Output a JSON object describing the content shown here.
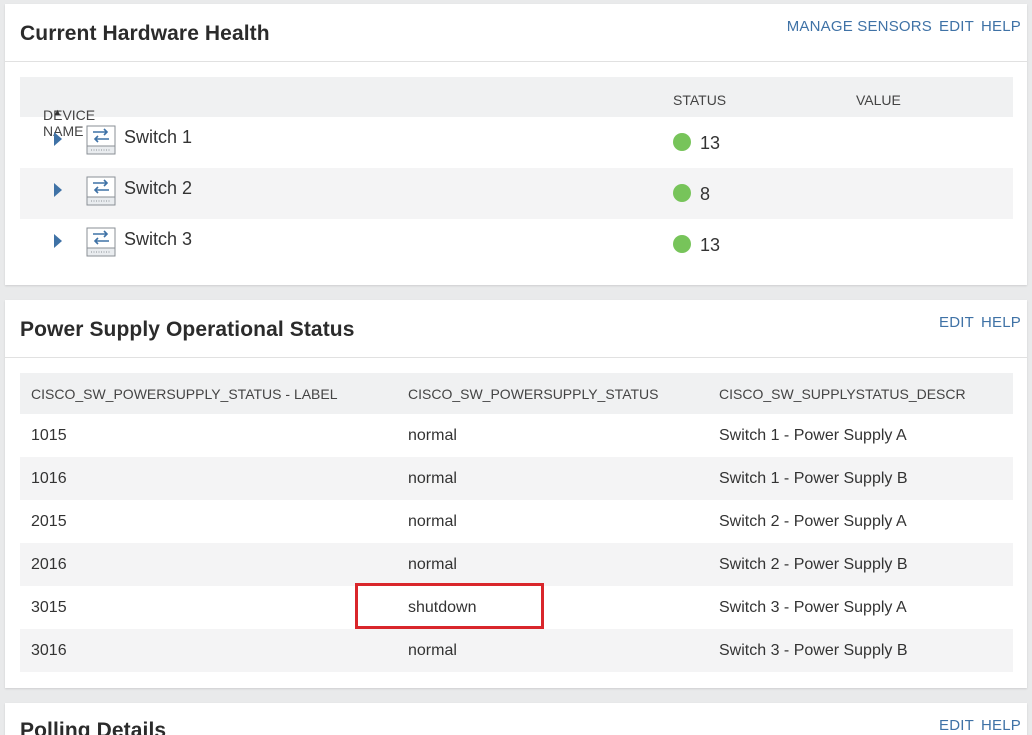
{
  "hardware_health": {
    "title": "Current Hardware Health",
    "links": [
      "MANAGE SENSORS",
      "EDIT",
      "HELP"
    ],
    "columns": {
      "device_name": "DEVICE NAME",
      "status": "STATUS",
      "value": "VALUE"
    },
    "rows": [
      {
        "name": "Switch 1",
        "status": "13"
      },
      {
        "name": "Switch 2",
        "status": "8"
      },
      {
        "name": "Switch 3",
        "status": "13"
      }
    ],
    "status_color": "#77c45a"
  },
  "power_supply": {
    "title": "Power Supply Operational Status",
    "links": [
      "EDIT",
      "HELP"
    ],
    "columns": [
      "CISCO_SW_POWERSUPPLY_STATUS - LABEL",
      "CISCO_SW_POWERSUPPLY_STATUS",
      "CISCO_SW_SUPPLYSTATUS_DESCR"
    ],
    "rows": [
      [
        "1015",
        "normal",
        "Switch 1 - Power Supply A"
      ],
      [
        "1016",
        "normal",
        "Switch 1 - Power Supply B"
      ],
      [
        "2015",
        "normal",
        "Switch 2 - Power Supply A"
      ],
      [
        "2016",
        "normal",
        "Switch 2 - Power Supply B"
      ],
      [
        "3015",
        "shutdown",
        "Switch 3 - Power Supply A"
      ],
      [
        "3016",
        "normal",
        "Switch 3 - Power Supply B"
      ]
    ]
  },
  "polling": {
    "title": "Polling Details",
    "links": [
      "EDIT",
      "HELP"
    ]
  },
  "highlight_color": "#d9262b"
}
